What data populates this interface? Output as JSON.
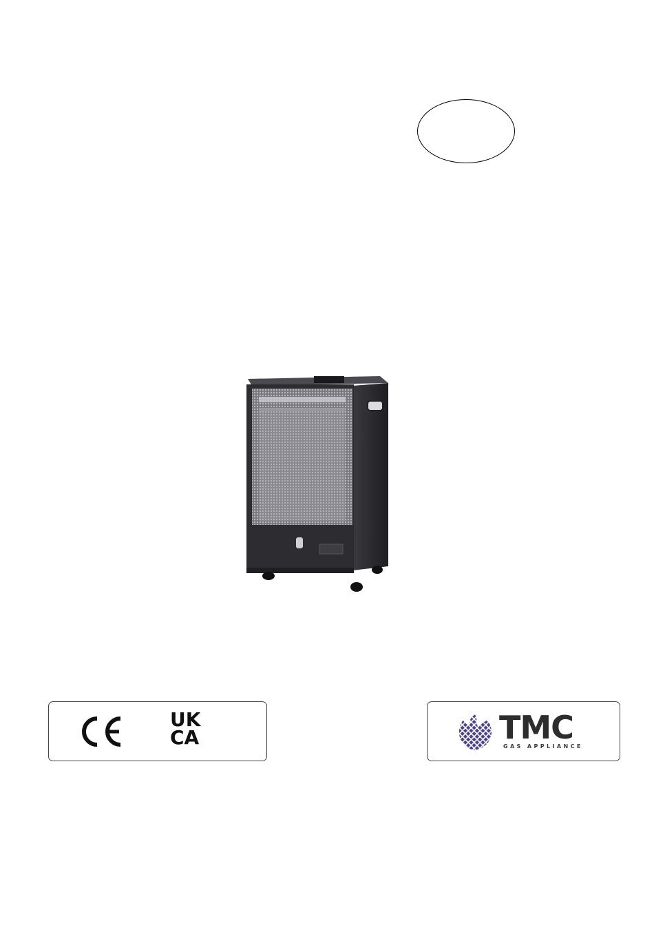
{
  "page": {
    "background": "#ffffff"
  },
  "product_image": {
    "description_icon": "gas-heater-illustration",
    "body_color": "#2e2e33",
    "grille_color": "#8c8c92"
  },
  "certifications": {
    "ce": "CE",
    "ukca_top": "UK",
    "ukca_bottom": "CA"
  },
  "brand": {
    "name": "TMC",
    "tagline": "GAS APPLIANCE",
    "accent": "#4a3f8c"
  }
}
